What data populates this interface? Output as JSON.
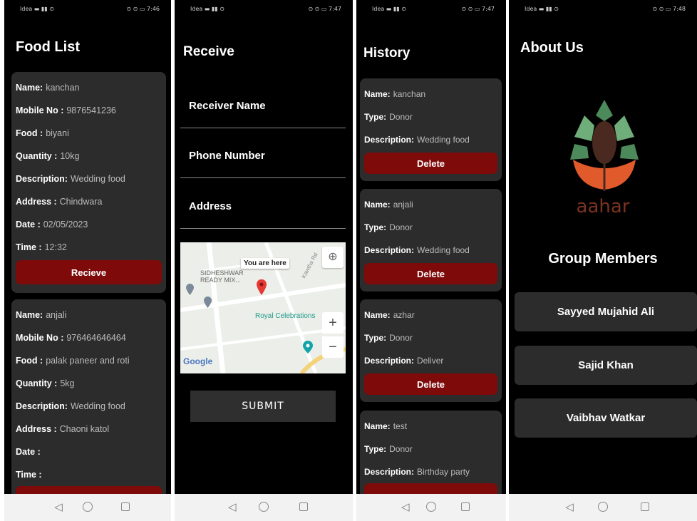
{
  "status_bars": [
    {
      "left": "Idea ▬ ▮▮ ⊙",
      "right": "⊙ ⊙ ▭ 7:46"
    },
    {
      "left": "Idea ▬ ▮▮ ⊙",
      "right": "⊙ ⊙ ▭ 7:47"
    },
    {
      "left": "Idea ▬ ▮▮ ⊙",
      "right": "⊙ ⊙ ▭ 7:47"
    },
    {
      "left": "Idea ▬ ▮▮ ⊙",
      "right": "⊙ ⊙ ▭ 7:48"
    }
  ],
  "food_list": {
    "title": "Food List",
    "labels": {
      "name": "Name:",
      "mobile": "Mobile No :",
      "food": "Food :",
      "quantity": "Quantity :",
      "description": "Description:",
      "address": "Address :",
      "date": "Date :",
      "time": "Time :"
    },
    "button_label": "Recieve",
    "items": [
      {
        "name": "kanchan",
        "mobile": "9876541236",
        "food": "biyani",
        "quantity": "10kg",
        "description": "Wedding food",
        "address": "Chindwara",
        "date": "02/05/2023",
        "time": "12:32"
      },
      {
        "name": "anjali",
        "mobile": "976464646464",
        "food": "palak paneer and roti",
        "quantity": "5kg",
        "description": "Wedding food",
        "address": "Chaoni katol",
        "date": "",
        "time": ""
      }
    ]
  },
  "receive": {
    "title": "Receive",
    "fields": {
      "receiver_name": "Receiver Name",
      "phone_number": "Phone Number",
      "address": "Address"
    },
    "map": {
      "you_are_here": "You are here",
      "place_1_line1": "SIDHESHWAR",
      "place_1_line2": "READY MIX...",
      "place_2": "Royal Celebrations",
      "road": "Kawtha Rd",
      "google": "Google"
    },
    "submit_label": "SUBMIT"
  },
  "history": {
    "title": "History",
    "labels": {
      "name": "Name:",
      "type": "Type:",
      "description": "Description:"
    },
    "button_label": "Delete",
    "items": [
      {
        "name": "kanchan",
        "type": "Donor",
        "description": "Wedding food"
      },
      {
        "name": "anjali",
        "type": "Donor",
        "description": "Wedding food"
      },
      {
        "name": "azhar",
        "type": "Donor",
        "description": "Deliver"
      },
      {
        "name": "test",
        "type": "Donor",
        "description": "Birthday party"
      }
    ]
  },
  "about": {
    "title": "About Us",
    "brand": "aahar",
    "group_title": "Group Members",
    "members": [
      "Sayyed Mujahid Ali",
      "Sajid Khan",
      "Vaibhav Watkar"
    ]
  },
  "icons": {
    "back": "back-triangle-icon",
    "home": "home-circle-icon",
    "recent": "recent-square-icon",
    "location": "gps-locate-icon"
  },
  "colors": {
    "background": "#000000",
    "card": "#2c2c2c",
    "accent": "#7e0a0a",
    "brand": "#7a3320"
  }
}
